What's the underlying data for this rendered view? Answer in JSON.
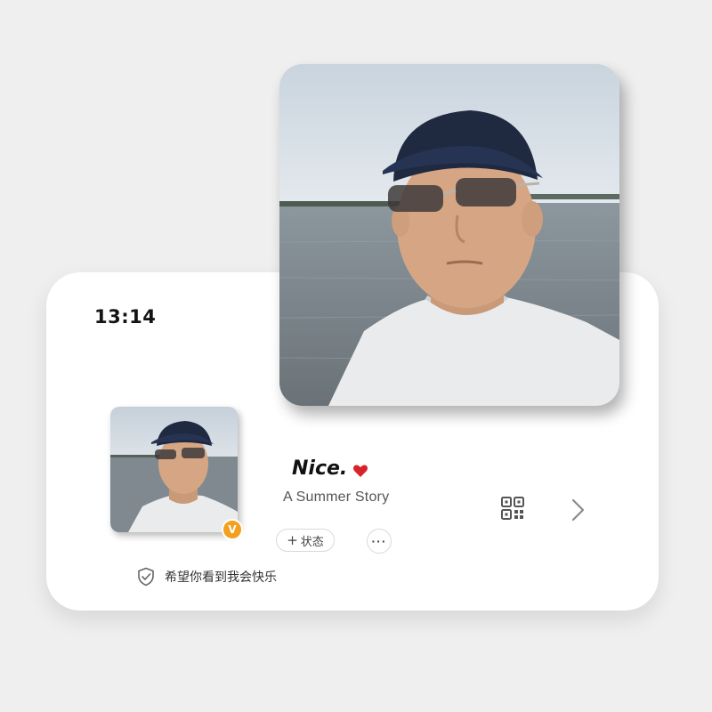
{
  "status_bar": {
    "time": "13:14"
  },
  "profile": {
    "nickname": "Nice.",
    "heart_icon": "heart-icon",
    "signature": "A Summer Story",
    "verified_badge": "V",
    "status_button": {
      "plus": "+",
      "label": "状态"
    },
    "more_button": {
      "label": "···"
    },
    "qr_icon": "qr-code-icon",
    "chevron_icon": "chevron-right-icon",
    "motto": "希望你看到我会快乐",
    "shield_icon": "shield-check-icon"
  },
  "colors": {
    "background": "#efefef",
    "card": "#ffffff",
    "heart": "#d8232a",
    "badge": "#f3a01f",
    "text_primary": "#111111",
    "text_secondary": "#555555"
  }
}
